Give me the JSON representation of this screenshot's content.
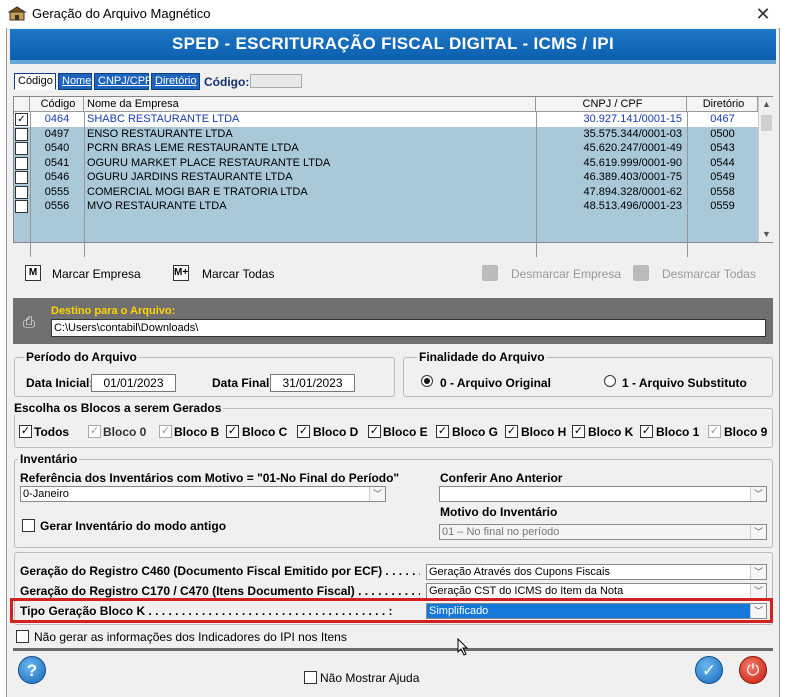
{
  "window": {
    "title": "Geração do Arquivo Magnético",
    "close_glyph": "✕"
  },
  "banner": "SPED - ESCRITURAÇÃO FISCAL DIGITAL - ICMS / IPI",
  "tabs": [
    "Código",
    "Nome",
    "CNPJ/CPF",
    "Diretório"
  ],
  "search": {
    "label": "Código:",
    "value": ""
  },
  "grid": {
    "columns": [
      "Código",
      "Nome da Empresa",
      "CNPJ / CPF",
      "Diretório"
    ],
    "rows": [
      {
        "checked": "✓",
        "codigo": "0464",
        "nome": "SHABC RESTAURANTE LTDA",
        "cnpj": "30.927.141/0001-15",
        "dir": "0467"
      },
      {
        "checked": "",
        "codigo": "0497",
        "nome": "ENSO RESTAURANTE LTDA",
        "cnpj": "35.575.344/0001-03",
        "dir": "0500"
      },
      {
        "checked": "",
        "codigo": "0540",
        "nome": "PCRN BRAS LEME RESTAURANTE LTDA",
        "cnpj": "45.620.247/0001-49",
        "dir": "0543"
      },
      {
        "checked": "",
        "codigo": "0541",
        "nome": "OGURU MARKET PLACE RESTAURANTE LTDA",
        "cnpj": "45.619.999/0001-90",
        "dir": "0544"
      },
      {
        "checked": "",
        "codigo": "0546",
        "nome": "OGURU JARDINS RESTAURANTE LTDA",
        "cnpj": "46.389.403/0001-75",
        "dir": "0549"
      },
      {
        "checked": "",
        "codigo": "0555",
        "nome": "COMERCIAL MOGI BAR E TRATORIA LTDA",
        "cnpj": "47.894.328/0001-62",
        "dir": "0558"
      },
      {
        "checked": "",
        "codigo": "0556",
        "nome": "MVO RESTAURANTE LTDA",
        "cnpj": "48.513.496/0001-23",
        "dir": "0559"
      }
    ]
  },
  "actions": {
    "marcar_empresa": "Marcar Empresa",
    "marcar_todas": "Marcar Todas",
    "desmarcar_empresa": "Desmarcar Empresa",
    "desmarcar_todas": "Desmarcar Todas",
    "icon_m": "M",
    "icon_mplus": "M+"
  },
  "destino": {
    "label": "Destino para o Arquivo:",
    "path": "C:\\Users\\contabil\\Downloads\\"
  },
  "periodo": {
    "title": "Período do Arquivo",
    "inicial_label": "Data Inicial:",
    "inicial": "01/01/2023",
    "final_label": "Data Final:",
    "final": "31/01/2023"
  },
  "finalidade": {
    "title": "Finalidade do Arquivo",
    "opt0": "0 - Arquivo Original",
    "opt1": "1 - Arquivo Substituto"
  },
  "blocos": {
    "title": "Escolha os Blocos a serem Gerados",
    "items": [
      {
        "label": "Todos",
        "checked": "✓"
      },
      {
        "label": "Bloco 0",
        "checked": "✓"
      },
      {
        "label": "Bloco B",
        "checked": "✓"
      },
      {
        "label": "Bloco C",
        "checked": "✓"
      },
      {
        "label": "Bloco D",
        "checked": "✓"
      },
      {
        "label": "Bloco E",
        "checked": "✓"
      },
      {
        "label": "Bloco G",
        "checked": "✓"
      },
      {
        "label": "Bloco H",
        "checked": "✓"
      },
      {
        "label": "Bloco K",
        "checked": "✓"
      },
      {
        "label": "Bloco 1",
        "checked": "✓"
      },
      {
        "label": "Bloco 9",
        "checked": "✓"
      }
    ]
  },
  "inventario": {
    "title": "Inventário",
    "ref_label": "Referência dos Inventários com Motivo = \"01-No Final do Período\"",
    "ref_value": "0-Janeiro",
    "conferir_label": "Conferir Ano Anterior",
    "conferir_value": "",
    "gerar_antigo": "Gerar Inventário do modo antigo",
    "motivo_label": "Motivo do Inventário",
    "motivo_value": "01 – No final no período"
  },
  "registros": {
    "c460_label": "Geração do Registro C460 (Documento Fiscal Emitido por ECF) . . . . . . . . . . :",
    "c460_value": "Geração Através dos Cupons Fiscais",
    "c170_label": "Geração do Registro C170 / C470 (Itens Documento Fiscal) . . . . . . . . . . . . :",
    "c170_value": "Geração CST do ICMS do Item da Nota",
    "blocok_label": "Tipo Geração Bloco K . . . . . . . . . . . . . . . . . . . . . . . . . . . . . . . . . . . . :",
    "blocok_value": "Simplificado"
  },
  "ipi_check": "Não gerar as informações dos Indicadores do IPI nos Itens",
  "footer": {
    "help": "?",
    "nao_mostrar": "Não Mostrar Ajuda",
    "ok": "✓",
    "power": "⏻"
  }
}
